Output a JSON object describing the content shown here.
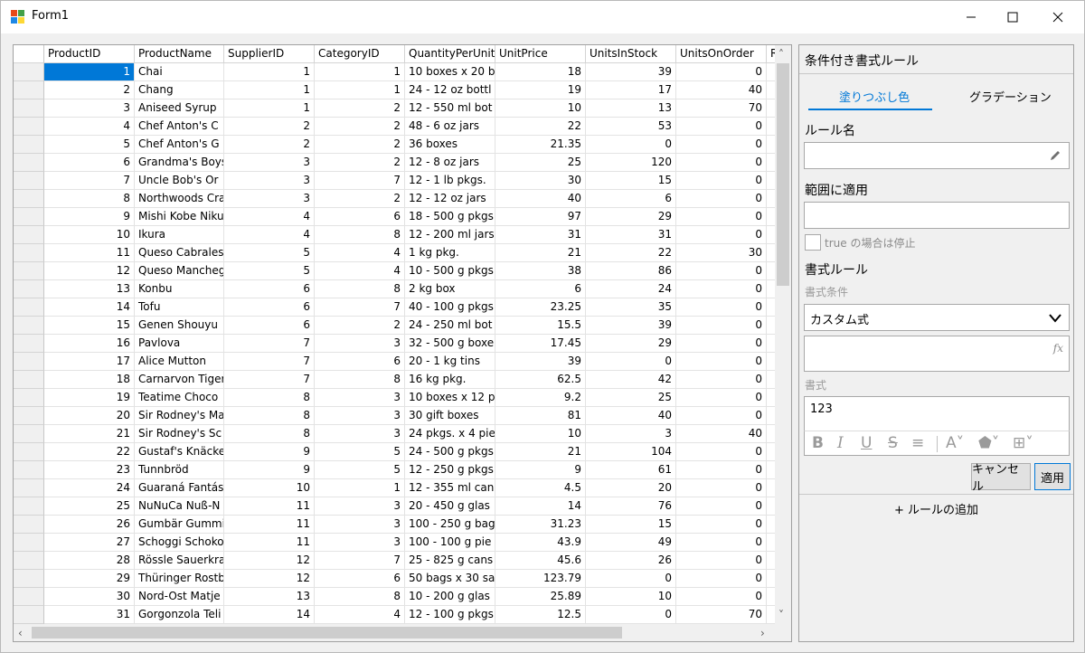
{
  "window": {
    "title": "Form1"
  },
  "grid": {
    "columns": [
      "ProductID",
      "ProductName",
      "SupplierID",
      "CategoryID",
      "QuantityPerUnit",
      "UnitPrice",
      "UnitsInStock",
      "UnitsOnOrder",
      "R"
    ],
    "rows": [
      [
        "1",
        "Chai",
        "1",
        "1",
        "10 boxes x 20 b",
        "18",
        "39",
        "0"
      ],
      [
        "2",
        "Chang",
        "1",
        "1",
        "24 - 12 oz bottl",
        "19",
        "17",
        "40"
      ],
      [
        "3",
        "Aniseed Syrup",
        "1",
        "2",
        "12 - 550 ml bot",
        "10",
        "13",
        "70"
      ],
      [
        "4",
        "Chef Anton's C",
        "2",
        "2",
        "48 - 6 oz jars",
        "22",
        "53",
        "0"
      ],
      [
        "5",
        "Chef Anton's G",
        "2",
        "2",
        "36 boxes",
        "21.35",
        "0",
        "0"
      ],
      [
        "6",
        "Grandma's Boys",
        "3",
        "2",
        "12 - 8 oz jars",
        "25",
        "120",
        "0"
      ],
      [
        "7",
        "Uncle Bob's Or",
        "3",
        "7",
        "12 - 1 lb pkgs.",
        "30",
        "15",
        "0"
      ],
      [
        "8",
        "Northwoods Cra",
        "3",
        "2",
        "12 - 12 oz jars",
        "40",
        "6",
        "0"
      ],
      [
        "9",
        "Mishi Kobe Niku",
        "4",
        "6",
        "18 - 500 g pkgs",
        "97",
        "29",
        "0"
      ],
      [
        "10",
        "Ikura",
        "4",
        "8",
        "12 - 200 ml jars",
        "31",
        "31",
        "0"
      ],
      [
        "11",
        "Queso Cabrales",
        "5",
        "4",
        "1 kg pkg.",
        "21",
        "22",
        "30"
      ],
      [
        "12",
        "Queso Manchego",
        "5",
        "4",
        "10 - 500 g pkgs",
        "38",
        "86",
        "0"
      ],
      [
        "13",
        "Konbu",
        "6",
        "8",
        "2 kg box",
        "6",
        "24",
        "0"
      ],
      [
        "14",
        "Tofu",
        "6",
        "7",
        "40 - 100 g pkgs",
        "23.25",
        "35",
        "0"
      ],
      [
        "15",
        "Genen Shouyu",
        "6",
        "2",
        "24 - 250 ml bot",
        "15.5",
        "39",
        "0"
      ],
      [
        "16",
        "Pavlova",
        "7",
        "3",
        "32 - 500 g boxe",
        "17.45",
        "29",
        "0"
      ],
      [
        "17",
        "Alice Mutton",
        "7",
        "6",
        "20 - 1 kg tins",
        "39",
        "0",
        "0"
      ],
      [
        "18",
        "Carnarvon Tigers",
        "7",
        "8",
        "16 kg pkg.",
        "62.5",
        "42",
        "0"
      ],
      [
        "19",
        "Teatime Choco",
        "8",
        "3",
        "10 boxes x 12 p",
        "9.2",
        "25",
        "0"
      ],
      [
        "20",
        "Sir Rodney's Ma",
        "8",
        "3",
        "30 gift boxes",
        "81",
        "40",
        "0"
      ],
      [
        "21",
        "Sir Rodney's Sc",
        "8",
        "3",
        "24 pkgs. x 4 pie",
        "10",
        "3",
        "40"
      ],
      [
        "22",
        "Gustaf's Knäcke",
        "9",
        "5",
        "24 - 500 g pkgs",
        "21",
        "104",
        "0"
      ],
      [
        "23",
        "Tunnbröd",
        "9",
        "5",
        "12 - 250 g pkgs",
        "9",
        "61",
        "0"
      ],
      [
        "24",
        "Guaraná Fantás",
        "10",
        "1",
        "12 - 355 ml can",
        "4.5",
        "20",
        "0"
      ],
      [
        "25",
        "NuNuCa Nuß-N",
        "11",
        "3",
        "20 - 450 g glas",
        "14",
        "76",
        "0"
      ],
      [
        "26",
        "Gumbär Gummib",
        "11",
        "3",
        "100 - 250 g bag",
        "31.23",
        "15",
        "0"
      ],
      [
        "27",
        "Schoggi Schoko",
        "11",
        "3",
        "100 - 100 g pie",
        "43.9",
        "49",
        "0"
      ],
      [
        "28",
        "Rössle Sauerkra",
        "12",
        "7",
        "25 - 825 g cans",
        "45.6",
        "26",
        "0"
      ],
      [
        "29",
        "Thüringer Rostb",
        "12",
        "6",
        "50 bags x 30 sa",
        "123.79",
        "0",
        "0"
      ],
      [
        "30",
        "Nord-Ost Matje",
        "13",
        "8",
        "10 - 200 g glas",
        "25.89",
        "10",
        "0"
      ],
      [
        "31",
        "Gorgonzola Teli",
        "14",
        "4",
        "12 - 100 g pkgs",
        "12.5",
        "0",
        "70"
      ]
    ],
    "selected_row": 0
  },
  "panel": {
    "title": "条件付き書式ルール",
    "tabs": {
      "fill": "塗りつぶし色",
      "gradient": "グラデーション"
    },
    "rule_name_label": "ルール名",
    "rule_name_value": "",
    "range_label": "範囲に適用",
    "range_value": "",
    "stop_if_true_label": "true の場合は停止",
    "format_rule_label": "書式ルール",
    "format_condition_label": "書式条件",
    "format_condition_value": "カスタム式",
    "formula_value": "",
    "format_label": "書式",
    "format_preview": "123",
    "cancel_button": "キャンセル",
    "apply_button": "適用",
    "add_rule": "+ ルールの追加"
  }
}
